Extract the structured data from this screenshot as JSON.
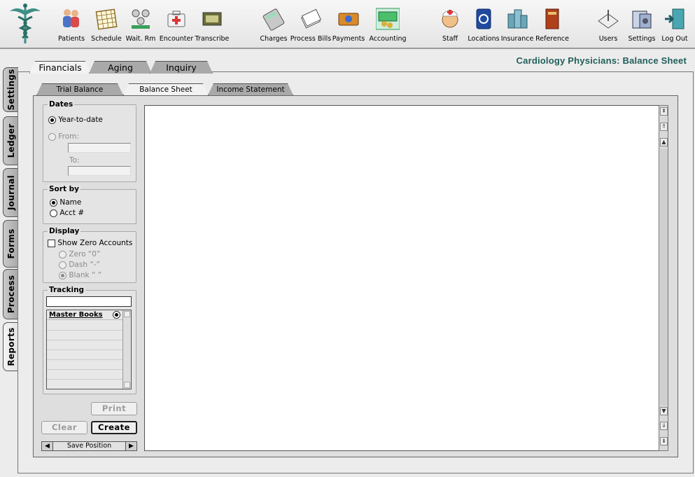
{
  "app": {
    "page_title": "Cardiology Physicians: Balance Sheet"
  },
  "toolbar": {
    "items": [
      {
        "label": "Patients",
        "icon": "patients-icon"
      },
      {
        "label": "Schedule",
        "icon": "schedule-icon"
      },
      {
        "label": "Wait. Rm",
        "icon": "waiting-room-icon"
      },
      {
        "label": "Encounter",
        "icon": "encounter-icon"
      },
      {
        "label": "Transcribe",
        "icon": "transcribe-icon"
      },
      {
        "label": "Charges",
        "icon": "charges-icon"
      },
      {
        "label": "Process Bills",
        "icon": "process-bills-icon"
      },
      {
        "label": "Payments",
        "icon": "payments-icon"
      },
      {
        "label": "Accounting",
        "icon": "accounting-icon"
      },
      {
        "label": "Staff",
        "icon": "staff-icon"
      },
      {
        "label": "Locations",
        "icon": "locations-icon"
      },
      {
        "label": "Insurance",
        "icon": "insurance-icon"
      },
      {
        "label": "Reference",
        "icon": "reference-icon"
      },
      {
        "label": "Users",
        "icon": "users-icon"
      },
      {
        "label": "Settings",
        "icon": "settings-icon"
      },
      {
        "label": "Log Out",
        "icon": "log-out-icon"
      }
    ]
  },
  "side_tabs": [
    "Settings",
    "Ledger",
    "Journal",
    "Forms",
    "Process",
    "Reports"
  ],
  "top_tabs": [
    "Financials",
    "Aging",
    "Inquiry"
  ],
  "sub_tabs": [
    "Trial Balance",
    "Balance Sheet",
    "Income Statement"
  ],
  "controls": {
    "dates": {
      "title": "Dates",
      "ytd_label": "Year-to-date",
      "from_label": "From:",
      "to_label": "To:",
      "from_value": "",
      "to_value": ""
    },
    "sort": {
      "title": "Sort by",
      "name_label": "Name",
      "acct_label": "Acct #"
    },
    "display": {
      "title": "Display",
      "show_zero_label": "Show Zero Accounts",
      "zero_label": "Zero “0”",
      "dash_label": "Dash “-”",
      "blank_label": "Blank “ ”"
    },
    "tracking": {
      "title": "Tracking",
      "search_value": "",
      "master_books_label": "Master Books"
    },
    "buttons": {
      "print": "Print",
      "clear": "Clear",
      "create": "Create",
      "save_position": "Save Position"
    }
  },
  "colors": {
    "title": "#215f5a",
    "accent_green": "#2e9c5a"
  }
}
